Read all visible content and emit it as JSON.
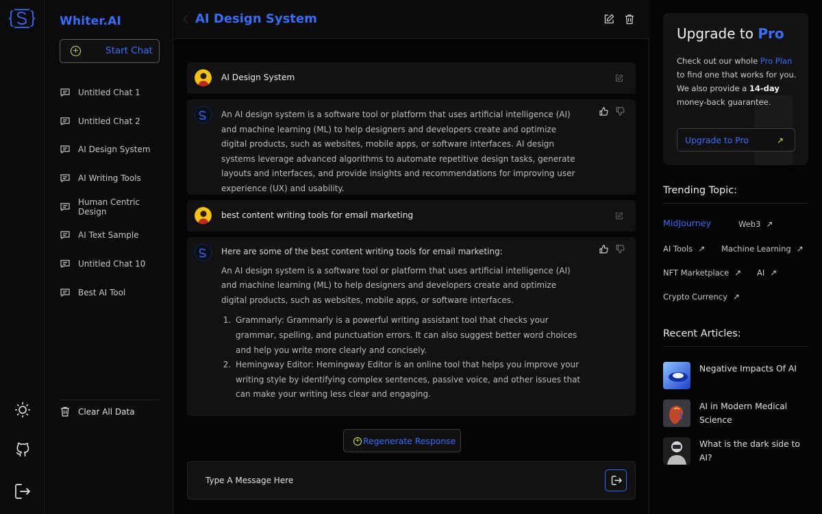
{
  "brand": "Whiter.AI",
  "sidebar": {
    "start_chat": "Start Chat",
    "chats": [
      "Untitled Chat 1",
      "Untitled Chat 2",
      "AI Design System",
      "AI Writing Tools",
      "Human Centric Design",
      "AI Text Sample",
      "Untitled Chat 10",
      "Best AI Tool"
    ],
    "clear_all": "Clear All Data"
  },
  "rail": {
    "icons": [
      "logo-icon",
      "sun-icon",
      "github-icon",
      "logout-icon"
    ]
  },
  "main": {
    "title": "AI Design System",
    "messages": [
      {
        "role": "user",
        "text": "AI Design System"
      },
      {
        "role": "assistant",
        "text": "An AI design system is a software tool or platform that uses artificial intelligence (AI) and machine learning (ML) to help designers and developers create and optimize digital products, such as websites, mobile apps, or software interfaces. AI design systems leverage advanced algorithms to automate repetitive design tasks, generate layouts and interfaces, and provide insights and recommendations for improving user experience (UX) and usability."
      },
      {
        "role": "user",
        "text": "best content writing tools for email marketing"
      },
      {
        "role": "assistant",
        "intro": "Here are some of the best content writing tools for email marketing:",
        "text": "An AI design system is a software tool or platform that uses artificial intelligence (AI) and machine learning (ML) to help designers and developers create and optimize digital products, such as websites, mobile apps, or software interfaces.",
        "list": [
          "Grammarly: Grammarly is a powerful writing assistant tool that checks your grammar, spelling, and punctuation errors. It can also suggest better word choices and help you write more clearly and concisely.",
          "Hemingway Editor: Hemingway Editor is an online tool that helps you improve your writing style by identifying complex sentences, passive voice, and other issues that can make your writing less clear and engaging."
        ]
      }
    ],
    "regenerate": "Regenerate Response",
    "composer_placeholder": "Type A Message Here"
  },
  "right": {
    "promo": {
      "title_prefix": "Upgrade to ",
      "title_highlight": "Pro",
      "line1_prefix": "Check out our whole ",
      "line1_highlight": "Pro Plan",
      "line2": "to find one that works for you.",
      "line3_prefix": "We also provide a ",
      "line3_bold": "14-day",
      "line4": "money-back guarantee.",
      "button": "Upgrade to Pro"
    },
    "trending_title": "Trending Topic:",
    "topics": [
      {
        "label": "MidJourney",
        "arrow": false,
        "active": true
      },
      {
        "label": "Web3",
        "arrow": true
      },
      {
        "label": "AI Tools",
        "arrow": true
      },
      {
        "label": "Machine Learning",
        "arrow": true
      },
      {
        "label": "NFT Marketplace",
        "arrow": true
      },
      {
        "label": "AI",
        "arrow": true
      },
      {
        "label": "Crypto Currency",
        "arrow": true
      }
    ],
    "articles_title": "Recent Articles:",
    "articles": [
      "Negative Impacts Of AI",
      "AI in Modern Medical Science",
      "What is the dark side to AI?"
    ]
  },
  "colors": {
    "accent": "#3b6cf6",
    "highlight": "#d6e84b",
    "background": "#050505",
    "panel": "#121214"
  }
}
